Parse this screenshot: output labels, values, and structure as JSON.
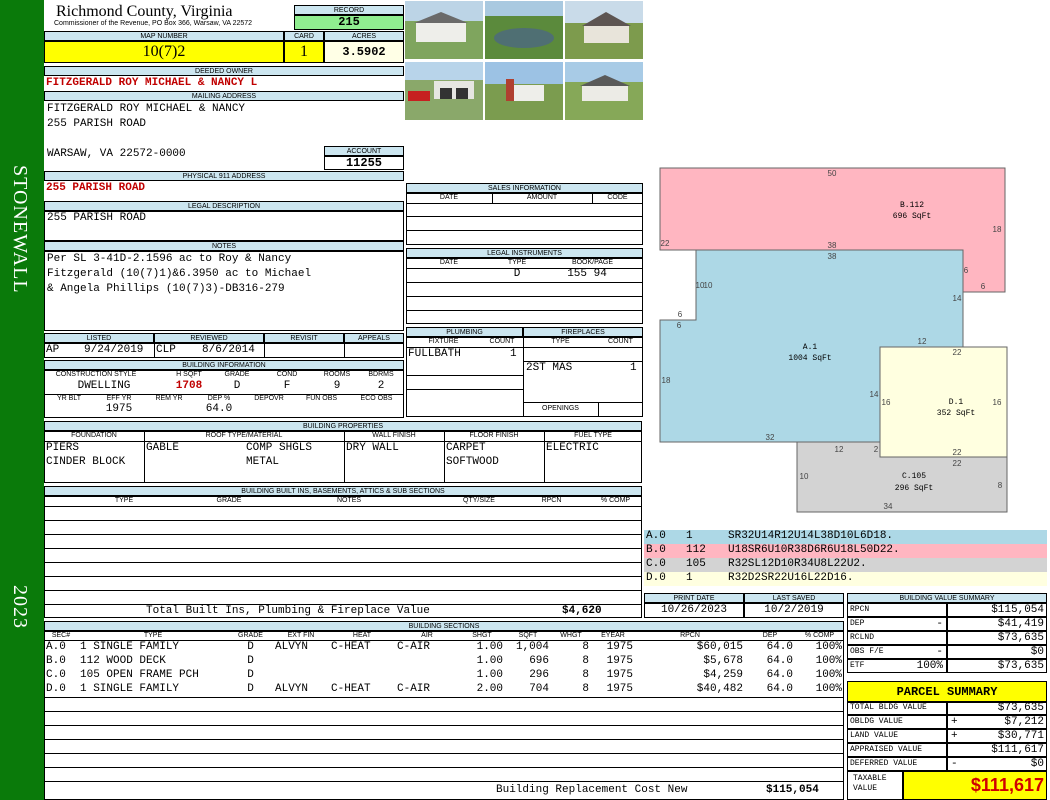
{
  "sidebar": {
    "district": "STONEWALL",
    "year": "2023"
  },
  "header": {
    "county": "Richmond County, Virginia",
    "address_line": "Commissioner of the Revenue, PO Box 366, Warsaw, VA 22572",
    "record_label": "RECORD",
    "record_value": "215",
    "map_label": "MAP NUMBER",
    "map_value": "10(7)2",
    "card_label": "CARD",
    "card_value": "1",
    "acres_label": "ACRES",
    "acres_value": "3.5902"
  },
  "owner": {
    "deeded_label": "DEEDED OWNER",
    "deeded_value": "FITZGERALD ROY MICHAEL & NANCY L",
    "mailing_label": "MAILING ADDRESS",
    "mailing_lines": [
      "FITZGERALD ROY MICHAEL & NANCY",
      "255 PARISH ROAD",
      "WARSAW, VA 22572-0000"
    ],
    "account_label": "ACCOUNT",
    "account_value": "11255",
    "physical_label": "PHYSICAL 911 ADDRESS",
    "physical_value": "255 PARISH ROAD",
    "legal_label": "LEGAL DESCRIPTION",
    "legal_value": "255 PARISH ROAD",
    "notes_label": "NOTES",
    "notes_lines": [
      "Per SL 3-41D-2.1596 ac to Roy & Nancy",
      "Fitzgerald (10(7)1)&6.3950 ac to Michael",
      "& Angela Phillips (10(7)3)-DB316-279"
    ]
  },
  "status": {
    "listed_label": "LISTED",
    "listed_by": "AP",
    "listed_date": "9/24/2019",
    "reviewed_label": "REVIEWED",
    "reviewed_by": "CLP",
    "reviewed_date": "8/6/2014",
    "revisit_label": "REVISIT",
    "appeals_label": "APPEALS"
  },
  "building_info": {
    "title": "BUILDING INFORMATION",
    "headers": [
      "CONSTRUCTION STYLE",
      "H SQFT",
      "GRADE",
      "COND",
      "ROOMS",
      "BDRMS"
    ],
    "values": [
      "DWELLING",
      "1708",
      "D",
      "F",
      "9",
      "2"
    ],
    "headers2": [
      "YR BLT",
      "EFF YR",
      "REM YR",
      "DEP %",
      "DEPOVR",
      "FUN OBS",
      "ECO OBS"
    ],
    "values2": [
      "",
      "1975",
      "",
      "64.0",
      "",
      "",
      ""
    ]
  },
  "sales": {
    "title": "SALES INFORMATION",
    "headers": [
      "DATE",
      "AMOUNT",
      "CODE"
    ]
  },
  "legal_instruments": {
    "title": "LEGAL INSTRUMENTS",
    "headers": [
      "DATE",
      "TYPE",
      "BOOK/PAGE"
    ],
    "row": [
      "",
      "D",
      "155 94"
    ]
  },
  "plumbing": {
    "title": "PLUMBING",
    "headers": [
      "FIXTURE",
      "COUNT"
    ],
    "fixture": "FULLBATH",
    "count": "1"
  },
  "fireplaces": {
    "title": "FIREPLACES",
    "headers": [
      "TYPE",
      "COUNT"
    ],
    "type": "2ST MAS",
    "count": "1",
    "openings_label": "OPENINGS"
  },
  "properties": {
    "title": "BUILDING PROPERTIES",
    "headers": [
      "FOUNDATION",
      "ROOF TYPE/MATERIAL",
      "WALL FINISH",
      "FLOOR FINISH",
      "FUEL TYPE"
    ],
    "foundation": [
      "PIERS",
      "CINDER BLOCK"
    ],
    "roof_type": "GABLE",
    "roof_material": [
      "COMP SHGLS",
      "METAL"
    ],
    "wall": "DRY WALL",
    "floor": [
      "CARPET",
      "SOFTWOOD"
    ],
    "fuel": "ELECTRIC"
  },
  "builtins": {
    "title": "BUILDING BUILT INS, BASEMENTS, ATTICS & SUB SECTIONS",
    "headers": [
      "TYPE",
      "GRADE",
      "NOTES",
      "QTY/SIZE",
      "RPCN",
      "% COMP"
    ],
    "total_label": "Total Built Ins, Plumbing & Fireplace Value",
    "total_value": "$4,620"
  },
  "print": {
    "print_label": "PRINT DATE",
    "print_value": "10/26/2023",
    "saved_label": "LAST SAVED",
    "saved_value": "10/2/2019"
  },
  "sections": {
    "title": "BUILDING SECTIONS",
    "headers": [
      "SEC#",
      "TYPE",
      "GRADE",
      "EXT FIN",
      "HEAT",
      "AIR",
      "SHGT",
      "SQFT",
      "WHGT",
      "EYEAR",
      "RPCN",
      "DEP",
      "% COMP"
    ],
    "rows": [
      [
        "A.0",
        "1 SINGLE FAMILY",
        "D",
        "ALVYN",
        "C-HEAT",
        "C-AIR",
        "1.00",
        "1,004",
        "8",
        "1975",
        "$60,015",
        "64.0",
        "100%"
      ],
      [
        "B.0",
        "112 WOOD DECK",
        "D",
        "",
        "",
        "",
        "1.00",
        "696",
        "8",
        "1975",
        "$5,678",
        "64.0",
        "100%"
      ],
      [
        "C.0",
        "105 OPEN FRAME PCH",
        "D",
        "",
        "",
        "",
        "1.00",
        "296",
        "8",
        "1975",
        "$4,259",
        "64.0",
        "100%"
      ],
      [
        "D.0",
        "1 SINGLE FAMILY",
        "D",
        "ALVYN",
        "C-HEAT",
        "C-AIR",
        "2.00",
        "704",
        "8",
        "1975",
        "$40,482",
        "64.0",
        "100%"
      ]
    ],
    "replacement_label": "Building Replacement Cost New",
    "replacement_value": "$115,054"
  },
  "sketch": {
    "areas": [
      {
        "code": "B.112",
        "area": "696 SqFt"
      },
      {
        "code": "A.1",
        "area": "1004 SqFt"
      },
      {
        "code": "D.1",
        "area": "352 SqFt"
      },
      {
        "code": "C.105",
        "area": "296 SqFt"
      }
    ],
    "dims": [
      "50",
      "18",
      "22",
      "38",
      "38",
      "6",
      "6",
      "10",
      "10",
      "6",
      "6",
      "14",
      "12",
      "18",
      "22",
      "16",
      "16",
      "14",
      "32",
      "12",
      "2",
      "22",
      "22",
      "10",
      "8",
      "34"
    ],
    "legend": [
      {
        "sec": "A.0",
        "num": "1",
        "path": "SR32U14R12U14L38D10L6D18.",
        "color": "#add8e6"
      },
      {
        "sec": "B.0",
        "num": "112",
        "path": "U18SR6U10R38D6R6U18L50D22.",
        "color": "#ffb6c1"
      },
      {
        "sec": "C.0",
        "num": "105",
        "path": "R32SL12D10R34U8L22U2.",
        "color": "#d3d3d3"
      },
      {
        "sec": "D.0",
        "num": "1",
        "path": "R32D2SR22U16L22D16.",
        "color": "#ffffe0"
      }
    ]
  },
  "value_summary": {
    "title": "BUILDING VALUE SUMMARY",
    "rows": [
      {
        "label": "RPCN",
        "sign": "",
        "value": "$115,054"
      },
      {
        "label": "DEP",
        "sign": "-",
        "value": "$41,419"
      },
      {
        "label": "RCLND",
        "sign": "",
        "value": "$73,635"
      },
      {
        "label": "OBS F/E",
        "sign": "-",
        "value": "$0"
      },
      {
        "label": "ETF",
        "sign": "100%",
        "value": "$73,635"
      }
    ]
  },
  "parcel": {
    "title": "PARCEL SUMMARY",
    "rows": [
      {
        "label": "TOTAL BLDG VALUE",
        "sign": "",
        "value": "$73,635"
      },
      {
        "label": "OBLDG VALUE",
        "sign": "+",
        "value": "$7,212"
      },
      {
        "label": "LAND VALUE",
        "sign": "+",
        "value": "$30,771"
      },
      {
        "label": "APPRAISED VALUE",
        "sign": "",
        "value": "$111,617"
      },
      {
        "label": "DEFERRED VALUE",
        "sign": "-",
        "value": "$0"
      }
    ],
    "taxable_label": "TAXABLE VALUE",
    "taxable_value": "$111,617"
  },
  "photos": [
    "photo-house-front",
    "photo-pond",
    "photo-house-side",
    "photo-garage-truck",
    "photo-house-back",
    "photo-house-yard"
  ]
}
